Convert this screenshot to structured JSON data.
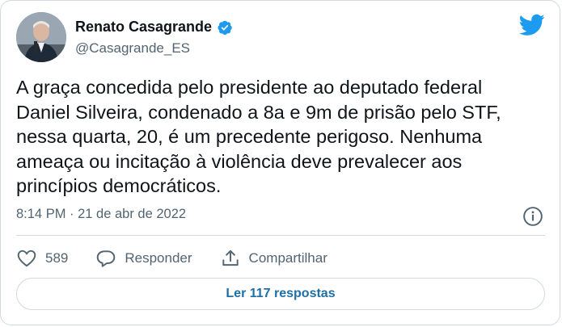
{
  "author": {
    "name": "Renato Casagrande",
    "handle": "@Casagrande_ES",
    "verified_icon": "verified-badge-icon",
    "avatar_icon": "profile-photo"
  },
  "tweet": {
    "text": "A graça concedida pelo presidente ao deputado federal\nDaniel Silveira, condenado a 8a e 9m de prisão pelo STF,\nnessa quarta, 20, é um precedente perigoso. Nenhuma\nameaça ou incitação à violência deve prevalecer aos\nprincípios democráticos.",
    "timestamp": "8:14 PM · 21 de abr de 2022"
  },
  "actions": {
    "like_count": "589",
    "reply_label": "Responder",
    "share_label": "Compartilhar"
  },
  "footer": {
    "replies_label": "Ler 117 respostas"
  },
  "colors": {
    "twitter_blue": "#1d9bf0",
    "link_blue": "#1d6fa5",
    "secondary_text": "#536471",
    "border": "#cfd9de"
  }
}
